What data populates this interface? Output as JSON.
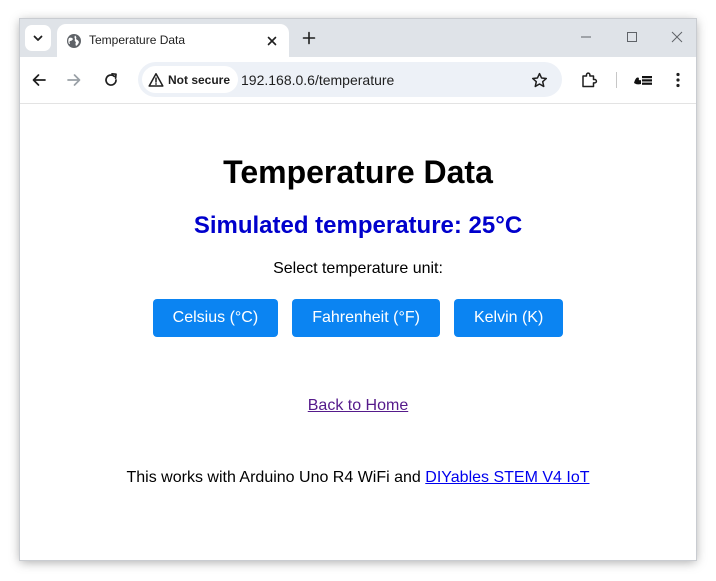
{
  "browser": {
    "tab_title": "Temperature Data",
    "security_label": "Not secure",
    "url": "192.168.0.6/temperature",
    "icons": {
      "tab_search": "chevron-down-icon",
      "tab_favicon": "globe-icon",
      "tab_close": "close-icon",
      "new_tab": "plus-icon",
      "minimize": "minimize-icon",
      "maximize": "maximize-icon",
      "close_window": "close-icon",
      "back": "arrow-left-icon",
      "forward": "arrow-right-icon",
      "reload": "reload-icon",
      "security": "warning-triangle-icon",
      "bookmark": "star-icon",
      "extensions": "puzzle-icon",
      "profile": "extension-logo-icon",
      "menu": "kebab-menu-icon"
    }
  },
  "page": {
    "title": "Temperature Data",
    "temperature_text": "Simulated temperature: 25°C",
    "unit_prompt": "Select temperature unit:",
    "unit_buttons": [
      {
        "label": "Celsius (°C)"
      },
      {
        "label": "Fahrenheit (°F)"
      },
      {
        "label": "Kelvin (K)"
      }
    ],
    "home_link": "Back to Home",
    "footer_text": "This works with Arduino Uno R4 WiFi and",
    "footer_link": "DIYables STEM V4 IoT"
  },
  "colors": {
    "tab_strip": "#dfe3e8",
    "omnibox": "#edf1f7",
    "temperature_text": "#0000cc",
    "button": "#0b84f2",
    "visited_link": "#551a8b",
    "link": "#0000ee"
  }
}
